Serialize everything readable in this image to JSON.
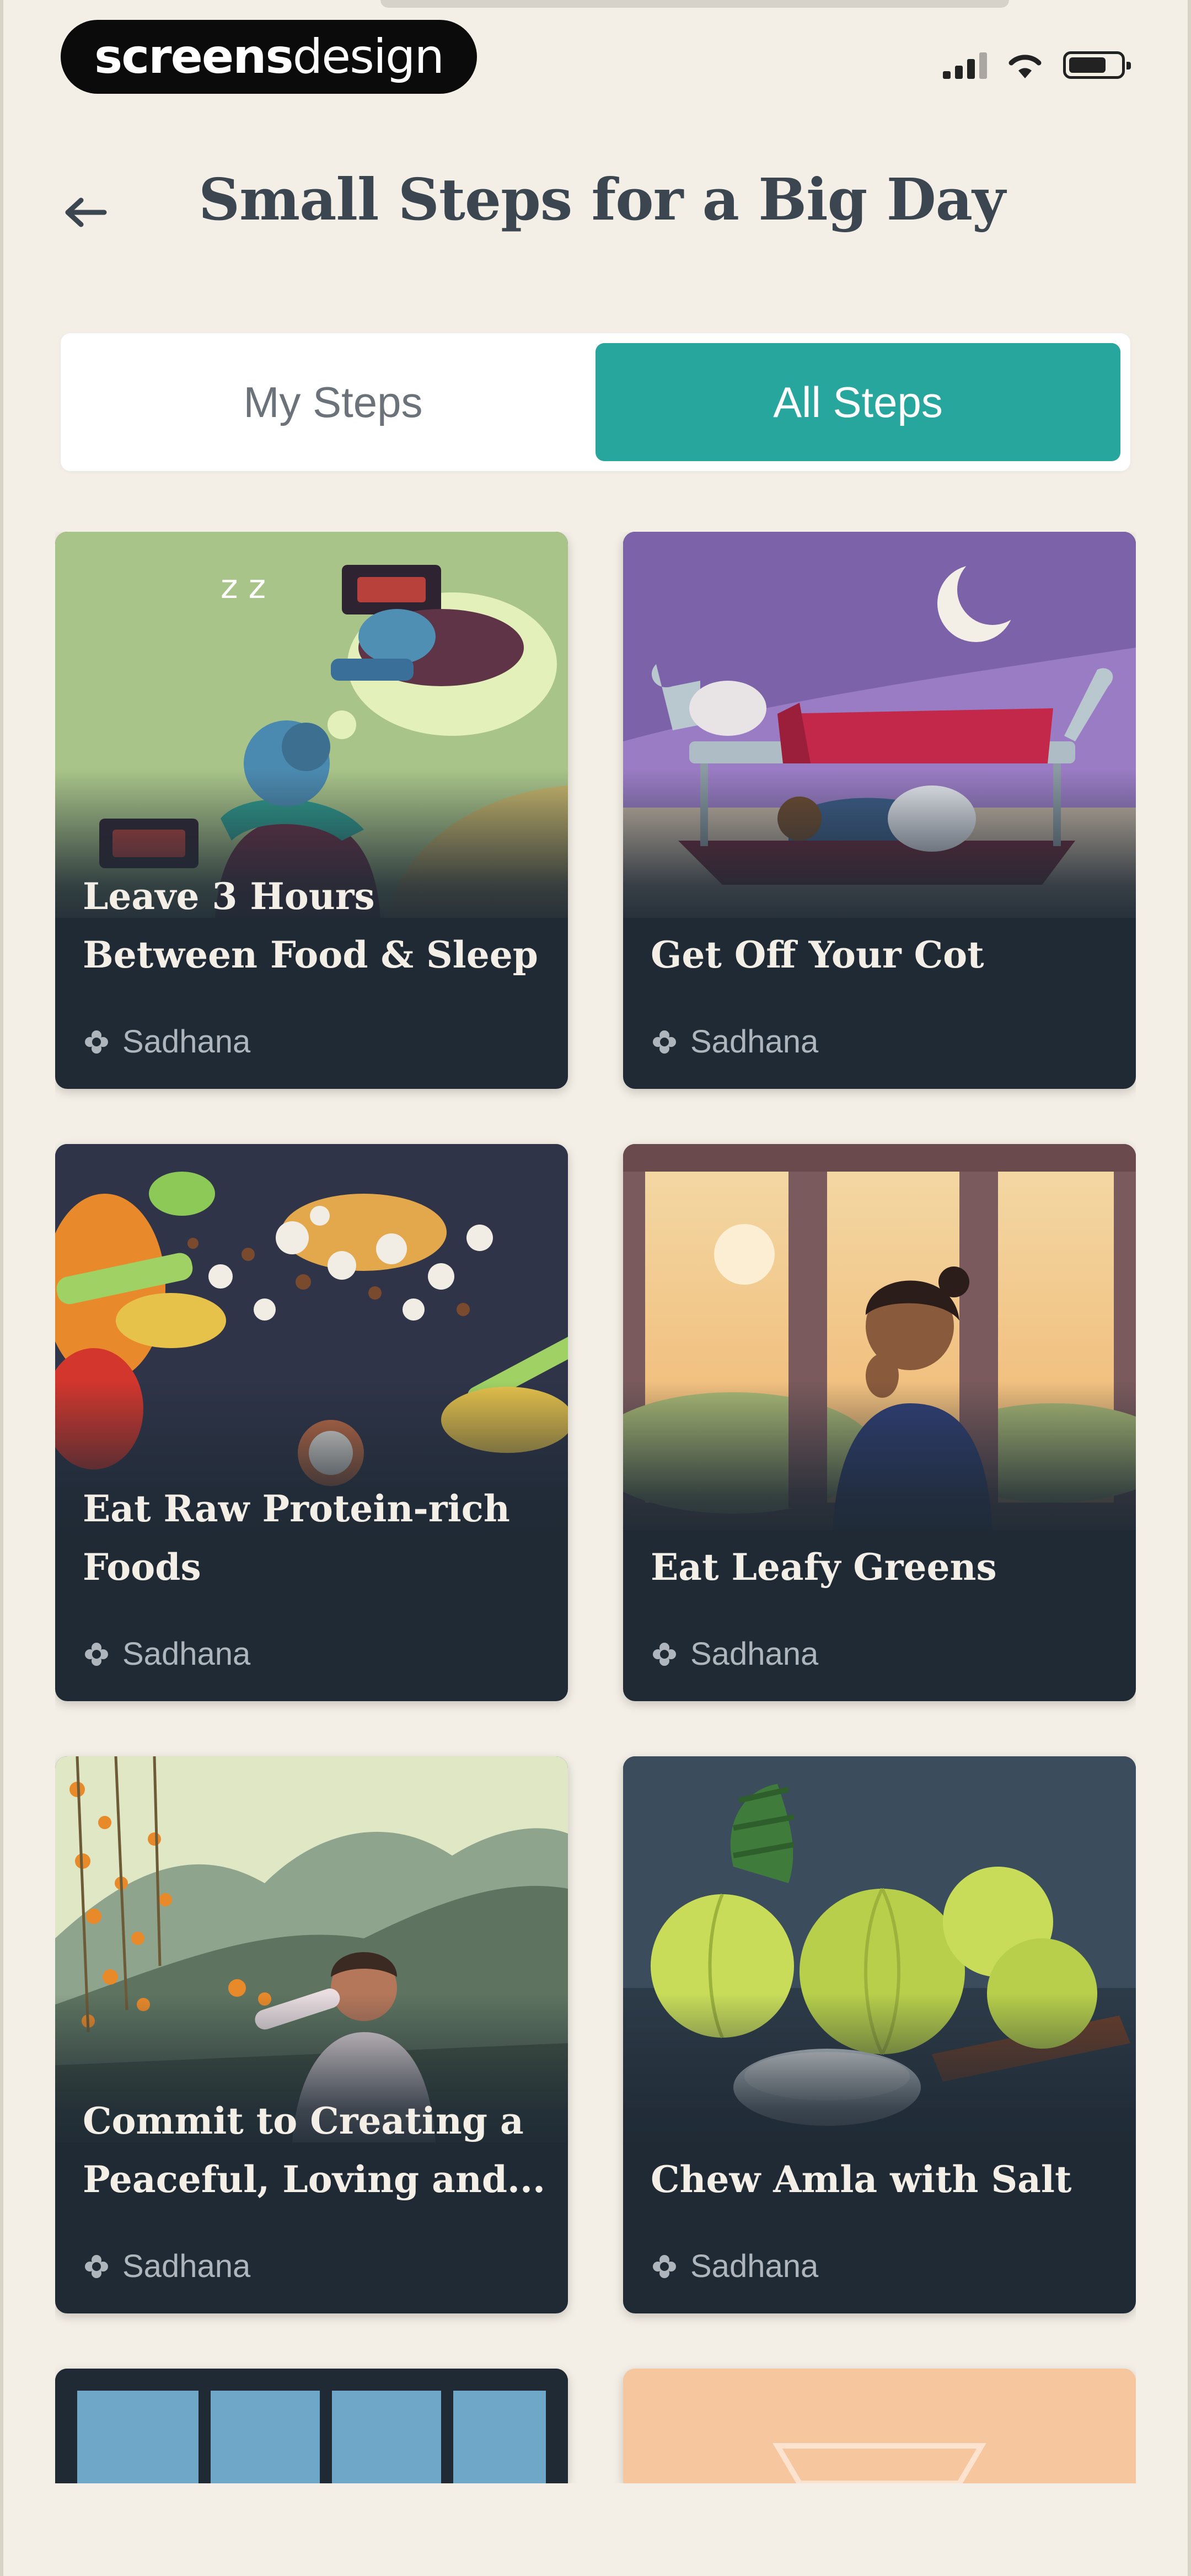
{
  "status_bar": {
    "brand_bold": "screens",
    "brand_light": "design"
  },
  "header": {
    "back_icon": "arrow-left-icon",
    "title": "Small Steps for a Big Day"
  },
  "tabs": [
    {
      "label": "My Steps",
      "active": false
    },
    {
      "label": "All Steps",
      "active": true
    }
  ],
  "cards": [
    {
      "title": "Leave 3 Hours Between Food & Sleep",
      "category": "Sadhana",
      "art": "sleep-dream-illustration"
    },
    {
      "title": "Get Off Your Cot",
      "category": "Sadhana",
      "art": "moon-cot-illustration"
    },
    {
      "title": "Eat Raw Protein-rich Foods",
      "category": "Sadhana",
      "art": "raw-foods-illustration"
    },
    {
      "title": "Eat Leafy Greens",
      "category": "Sadhana",
      "art": "window-woman-illustration"
    },
    {
      "title": "Commit to Creating a Peaceful, Loving and...",
      "category": "Sadhana",
      "art": "flowers-mountain-illustration"
    },
    {
      "title": "Chew Amla with Salt",
      "category": "Sadhana",
      "art": "amla-salt-illustration"
    }
  ],
  "colors": {
    "background": "#f3efe6",
    "accent": "#27a69e",
    "card": "#1f2a35",
    "title_text": "#3c4650"
  }
}
